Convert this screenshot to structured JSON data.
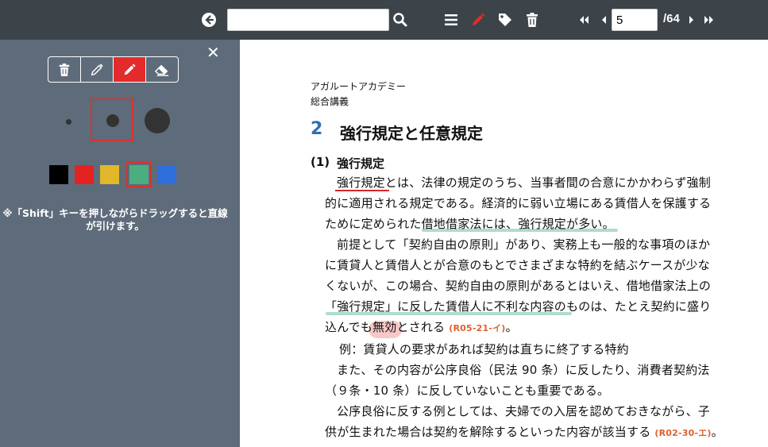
{
  "toolbar": {
    "search_placeholder": "",
    "page_current": "5",
    "page_total": "/64",
    "icons": [
      "back-icon",
      "search-icon",
      "menu-icon",
      "pen-icon",
      "tag-icon",
      "trash-icon",
      "first-page-icon",
      "prev-page-icon",
      "next-page-icon",
      "last-page-icon"
    ],
    "colors": {
      "bar": "#3c4349",
      "active_pen": "#e32b2b"
    }
  },
  "panel": {
    "close_label": "✕",
    "tools": [
      "trash-icon",
      "pencil-icon",
      "pen-icon",
      "eraser-icon"
    ],
    "active_tool": "pen-icon",
    "sizes": [
      "small",
      "medium",
      "large"
    ],
    "selected_size": "medium",
    "swatches": [
      "#000000",
      "#e32222",
      "#e0b82a",
      "#4cae80",
      "#2f6fdc"
    ],
    "selected_swatch": "#4cae80",
    "hint": "※「Shift」キーを押しながらドラッグすると直線が引けます。"
  },
  "document": {
    "header_line1": "アガルートアカデミー",
    "header_line2": "総合講義",
    "section_number": "2",
    "section_title": "強行規定と任意規定",
    "subsection_number": "(1)",
    "subsection_title": "強行規定",
    "lines": [
      "強行規定とは、法律の規定のうち、当事者間の合意にかかわらず強制",
      "的に適用される規定である。経済的に弱い立場にある賃借人を保護する",
      "ために定められた借地借家法には、強行規定が多い。",
      "前提として「契約自由の原則」があり、実務上も一般的な事項のほか",
      "に賃貸人と賃借人とが合意のもとでさまざまな特約を結ぶケースが少な",
      "くないが、この場合、契約自由の原則があるとはいえ、借地借家法上の",
      "「強行規定」に反した賃借人に不利な内容のものは、たとえ契約に盛り",
      "込んでも無効とされる",
      "例：賃貸人の要求があれば契約は直ちに終了する特約",
      "また、その内容が公序良俗（民法 90 条）に反したり、消費者契約法",
      "（９条・10 条）に反していないことも重要である。",
      "公序良俗に反する例としては、夫婦での入居を認めておきながら、子",
      "供が生まれた場合は契約を解除するといった内容が該当する"
    ],
    "ref1": "(R05-21-イ)",
    "ref1_tail": "。",
    "ref2": "(R02-30-エ)",
    "ref2_tail": "。"
  }
}
